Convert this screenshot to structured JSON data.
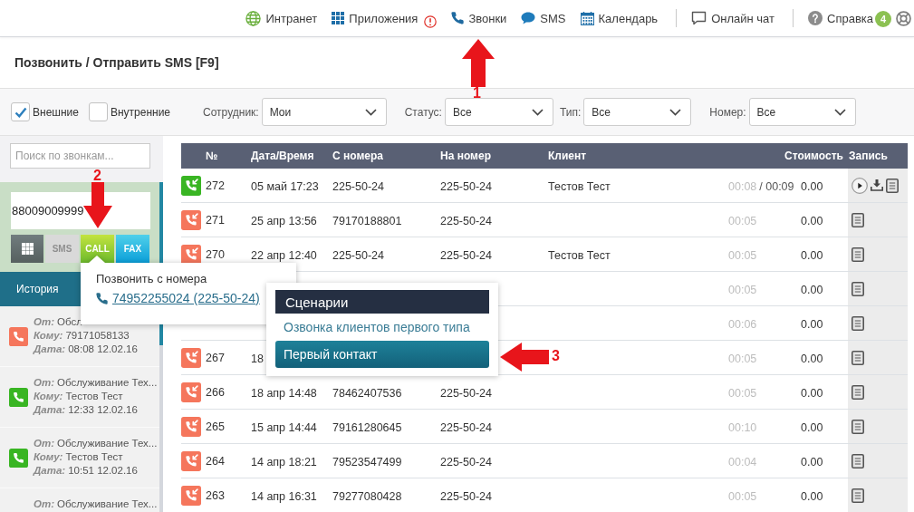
{
  "top_nav": {
    "groups": [
      {
        "items": [
          {
            "label": "Интранет",
            "alert": false
          },
          {
            "label": "Приложения",
            "alert": true
          },
          {
            "label": "Звонки",
            "alert": false
          },
          {
            "label": "SMS",
            "alert": false
          },
          {
            "label": "Календарь",
            "alert": false
          }
        ]
      },
      {
        "items": [
          {
            "label": "Онлайн чат",
            "alert": false
          }
        ]
      },
      {
        "items": [
          {
            "label": "Справка",
            "alert": false,
            "badge": "4"
          }
        ]
      }
    ]
  },
  "page_title": "Позвонить / Отправить SMS [F9]",
  "filters": {
    "checkboxes": [
      {
        "label": "Внешние",
        "checked": true
      },
      {
        "label": "Внутренние",
        "checked": false
      }
    ],
    "selects": [
      {
        "label": "Сотрудник:",
        "value": "Мои"
      },
      {
        "label": "Статус:",
        "value": "Все"
      },
      {
        "label": "Тип:",
        "value": "Все"
      },
      {
        "label": "Номер:",
        "value": "Все"
      }
    ]
  },
  "sidebar": {
    "search": {
      "placeholder": "Поиск по звонкам..."
    },
    "dialer": {
      "value": "88009009999",
      "buttons": [
        {
          "kind": "keypad",
          "disabled": false
        },
        {
          "kind": "sms",
          "label": "SMS",
          "disabled": true
        },
        {
          "kind": "call",
          "label": "CALL",
          "disabled": false
        },
        {
          "kind": "fax",
          "label": "FAX",
          "disabled": false
        }
      ]
    },
    "tabs": [
      {
        "label": "История",
        "selected": true
      }
    ],
    "history": [
      {
        "color": "#f5765c",
        "fields": [
          {
            "label": "От:",
            "value": "Обсл"
          },
          {
            "label": "Кому:",
            "value": "79171058133"
          },
          {
            "label": "Дата:",
            "value": "08:08 12.02.16"
          }
        ]
      },
      {
        "color": "#39b523",
        "fields": [
          {
            "label": "От:",
            "value": "Обслуживание Тех..."
          },
          {
            "label": "Кому:",
            "value": "Тестов Тест"
          },
          {
            "label": "Дата:",
            "value": "12:33 12.02.16"
          }
        ]
      },
      {
        "color": "#39b523",
        "fields": [
          {
            "label": "От:",
            "value": "Обслуживание Тех..."
          },
          {
            "label": "Кому:",
            "value": "Тестов Тест"
          },
          {
            "label": "Дата:",
            "value": "10:51 12.02.16"
          }
        ]
      },
      {
        "fields": [
          {
            "label": "От:",
            "value": "Обслуживание Тех..."
          }
        ]
      }
    ]
  },
  "table": {
    "columns": [
      "№",
      "Дата/Время",
      "С номера",
      "На номер",
      "Клиент",
      "Стоимость",
      "Запись"
    ],
    "rows": [
      {
        "color": "#39b523",
        "number": "272",
        "datetime": "05 май 17:23",
        "from": "225-50-24",
        "to": "225-50-24",
        "client": "Тестов Тест",
        "duration": "00:08",
        "talk_time": "/ 00:09",
        "cost": "0.00",
        "recording": true
      },
      {
        "color": "#f5765c",
        "number": "271",
        "datetime": "25 апр 13:56",
        "from": "79170188801",
        "to": "225-50-24",
        "duration": "00:05",
        "cost": "0.00",
        "recording": false
      },
      {
        "color": "#f5765c",
        "number": "270",
        "datetime": "22 апр 12:40",
        "from": "225-50-24",
        "to": "225-50-24",
        "client": "Тестов Тест",
        "duration": "00:05",
        "cost": "0.00",
        "recording": false
      },
      {
        "duration": "00:05",
        "cost": "0.00",
        "recording": false
      },
      {
        "duration": "00:06",
        "cost": "0.00",
        "recording": false
      },
      {
        "color": "#f5765c",
        "number": "267",
        "datetime": "18",
        "duration": "00:05",
        "cost": "0.00",
        "recording": false
      },
      {
        "color": "#f5765c",
        "number": "266",
        "datetime": "18 апр 14:48",
        "from": "78462407536",
        "to": "225-50-24",
        "duration": "00:05",
        "cost": "0.00",
        "recording": false
      },
      {
        "color": "#f5765c",
        "number": "265",
        "datetime": "15 апр 14:44",
        "from": "79161280645",
        "to": "225-50-24",
        "duration": "00:10",
        "cost": "0.00",
        "recording": false
      },
      {
        "color": "#f5765c",
        "number": "264",
        "datetime": "14 апр 18:21",
        "from": "79523547499",
        "to": "225-50-24",
        "duration": "00:04",
        "cost": "0.00",
        "recording": false
      },
      {
        "color": "#f5765c",
        "number": "263",
        "datetime": "14 апр 16:31",
        "from": "79277080428",
        "to": "225-50-24",
        "duration": "00:05",
        "cost": "0.00",
        "recording": false
      }
    ]
  },
  "call_from_popup": {
    "title": "Позвонить с номера",
    "number": "74952255024 (225-50-24)"
  },
  "scenarios_menu": {
    "title": "Сценарии",
    "items": [
      {
        "label": "Озвонка клиентов первого типа",
        "selected": false
      },
      {
        "label": "Первый контакт",
        "selected": true
      }
    ]
  },
  "annotations": [
    {
      "label": "1",
      "kind": "up"
    },
    {
      "label": "2",
      "kind": "down"
    },
    {
      "label": "3",
      "kind": "left"
    }
  ]
}
